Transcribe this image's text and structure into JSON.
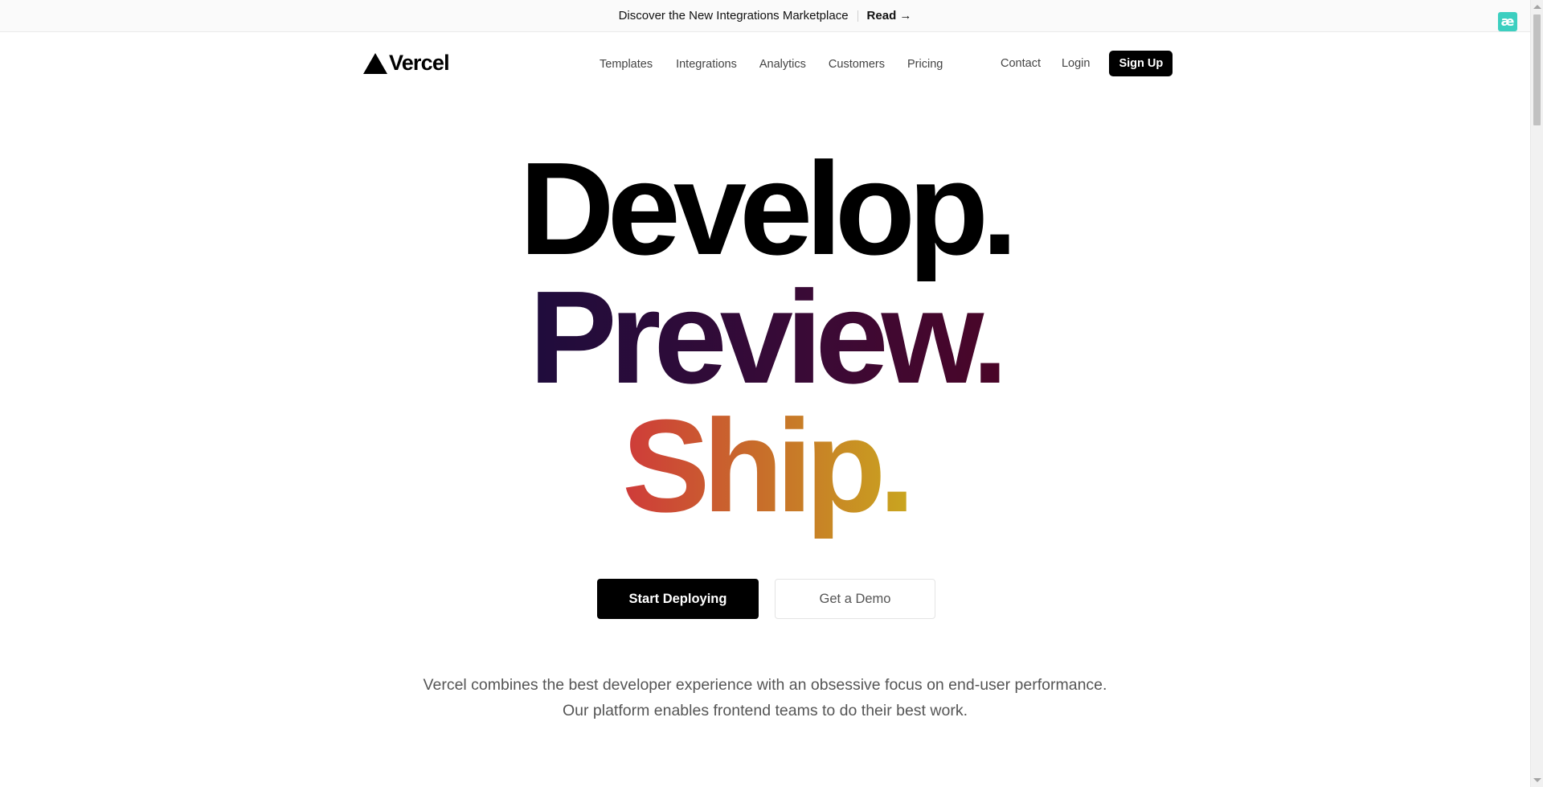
{
  "banner": {
    "message": "Discover the New Integrations Marketplace",
    "link_label": "Read →"
  },
  "extension": {
    "label": "æ"
  },
  "header": {
    "logo_text": "Vercel",
    "nav": [
      "Templates",
      "Integrations",
      "Analytics",
      "Customers",
      "Pricing"
    ],
    "contact_label": "Contact",
    "login_label": "Login",
    "signup_label": "Sign Up"
  },
  "hero": {
    "line1": "Develop.",
    "line2": "Preview.",
    "line3": "Ship."
  },
  "cta": {
    "primary_label": "Start Deploying",
    "secondary_label": "Get a Demo"
  },
  "description": {
    "line1": "Vercel combines the best developer experience with an obsessive focus on end-user performance.",
    "line2": "Our platform enables frontend teams to do their best work."
  },
  "colors": {
    "brand": "#000000",
    "preview_gradient": [
      "#1f0c3c",
      "#4a0528"
    ],
    "ship_gradient": [
      "#cf3a3a",
      "#c86a2b",
      "#c9a51f"
    ]
  }
}
